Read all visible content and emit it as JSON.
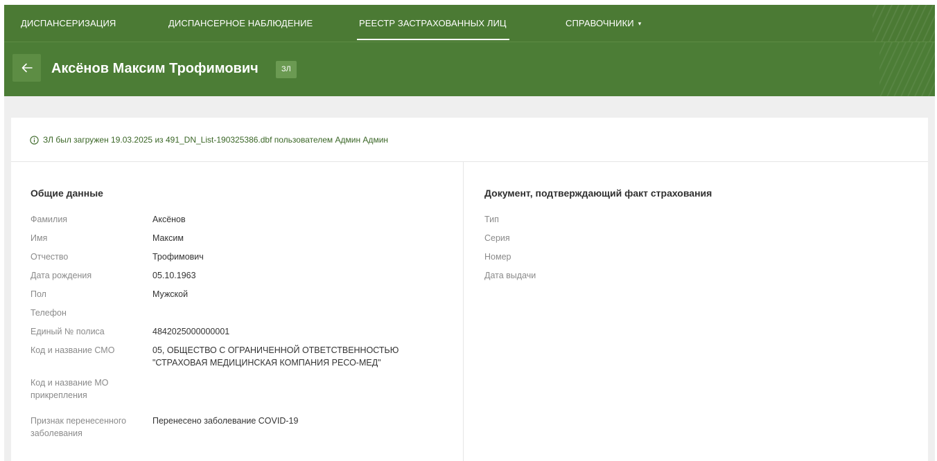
{
  "nav": {
    "items": [
      {
        "label": "ДИСПАНСЕРИЗАЦИЯ"
      },
      {
        "label": "ДИСПАНСЕРНОЕ НАБЛЮДЕНИЕ"
      },
      {
        "label": "РЕЕСТР ЗАСТРАХОВАННЫХ ЛИЦ"
      },
      {
        "label": "СПРАВОЧНИКИ"
      }
    ],
    "active_index": 2,
    "dropdown_caret": "▾"
  },
  "header": {
    "back_icon": "arrow-left-icon",
    "title": "Аксёнов Максим Трофимович",
    "badge": "ЗЛ"
  },
  "notice": {
    "icon": "info-circle-icon",
    "text": "ЗЛ был загружен 19.03.2025 из 491_DN_List-190325386.dbf пользователем Админ Админ"
  },
  "general": {
    "title": "Общие данные",
    "rows": [
      {
        "label": "Фамилия",
        "value": "Аксёнов"
      },
      {
        "label": "Имя",
        "value": "Максим"
      },
      {
        "label": "Отчество",
        "value": "Трофимович"
      },
      {
        "label": "Дата рождения",
        "value": "05.10.1963"
      },
      {
        "label": "Пол",
        "value": "Мужской"
      },
      {
        "label": "Телефон",
        "value": ""
      },
      {
        "label": "Единый № полиса",
        "value": "4842025000000001"
      },
      {
        "label": "Код и название СМО",
        "value_line1": "05, ОБЩЕСТВО С ОГРАНИЧЕННОЙ ОТВЕТСТВЕННОСТЬЮ",
        "value_line2": "\"СТРАХОВАЯ МЕДИЦИНСКАЯ КОМПАНИЯ РЕСО-МЕД\""
      },
      {
        "label_line1": "Код и название МО",
        "label_line2": "прикрепления",
        "value": ""
      },
      {
        "label_line1": "Признак перенесенного",
        "label_line2": "заболевания",
        "value": "Перенесено заболевание COVID-19"
      }
    ]
  },
  "document": {
    "title": "Документ, подтверждающий факт страхования",
    "rows": [
      {
        "label": "Тип",
        "value": ""
      },
      {
        "label": "Серия",
        "value": ""
      },
      {
        "label": "Номер",
        "value": ""
      },
      {
        "label": "Дата выдачи",
        "value": ""
      }
    ]
  },
  "colors": {
    "nav_bg": "#4b7a34",
    "header_bg": "#4c7d36",
    "accent_text": "#3a6626"
  }
}
